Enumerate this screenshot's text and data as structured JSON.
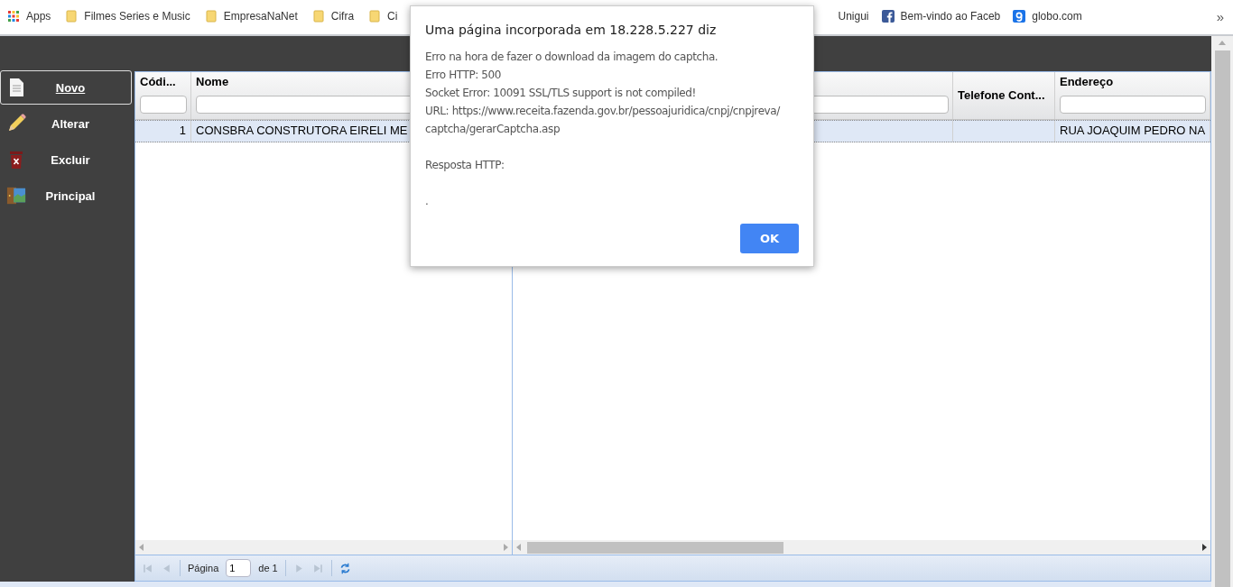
{
  "bookmarks": [
    {
      "kind": "apps",
      "label": "Apps"
    },
    {
      "kind": "folder",
      "label": "Filmes Series e Music"
    },
    {
      "kind": "folder",
      "label": "EmpresaNaNet"
    },
    {
      "kind": "folder",
      "label": "Cifra"
    },
    {
      "kind": "folder",
      "label": "Ci"
    }
  ],
  "bookmarks_right": [
    {
      "kind": "plain",
      "label": "Unigui"
    },
    {
      "kind": "facebook",
      "label": "Bem-vindo ao Faceb"
    },
    {
      "kind": "globo",
      "label": "globo.com"
    }
  ],
  "bookmarks_more": "»",
  "sidebar": {
    "items": [
      {
        "label": "Novo",
        "selected": true
      },
      {
        "label": "Alterar",
        "selected": false
      },
      {
        "label": "Excluir",
        "selected": false
      },
      {
        "label": "Principal",
        "selected": false
      }
    ]
  },
  "grid": {
    "columns": [
      {
        "kind": "code",
        "label": "Códi...",
        "filter": true
      },
      {
        "kind": "name",
        "label": "Nome",
        "filter": true
      }
    ],
    "columns_right": [
      {
        "kind": "hidden",
        "filter": true
      },
      {
        "kind": "phone",
        "label": "Telefone Cont...",
        "filter": false
      },
      {
        "kind": "address",
        "label": "Endereço",
        "filter": true
      }
    ],
    "rows": [
      {
        "selected": true,
        "code": "1",
        "name": "CONSBRA CONSTRUTORA EIRELI ME",
        "address": "RUA JOAQUIM PEDRO NA"
      }
    ]
  },
  "pager": {
    "page_label": "Página",
    "page": "1",
    "of": "de 1"
  },
  "dialog": {
    "title": "Uma página incorporada em 18.228.5.227 diz",
    "lines": [
      "Erro na hora de fazer o download da imagem do captcha.",
      "Erro HTTP: 500",
      "Socket Error: 10091 SSL/TLS support is not compiled!",
      "URL: https://www.receita.fazenda.gov.br/pessoajuridica/cnpj/cnpjreva/ captcha/gerarCaptcha.asp"
    ],
    "response_label": "Resposta HTTP:",
    "response": ".",
    "button": "OK"
  }
}
